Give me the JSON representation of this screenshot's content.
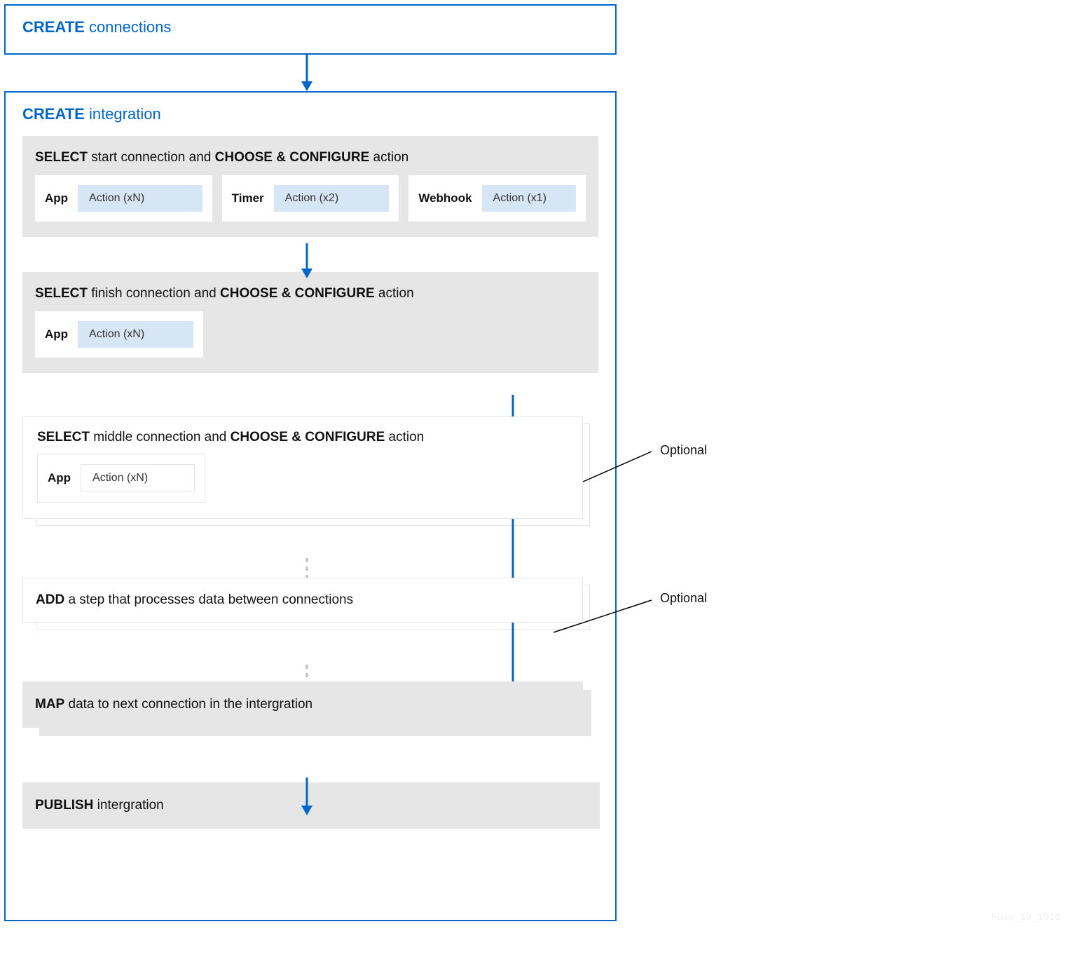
{
  "top": {
    "verb": "CREATE",
    "rest": " connections"
  },
  "main": {
    "verb": "CREATE",
    "rest": " integration"
  },
  "start": {
    "title_select": "SELECT",
    "title_mid": " start connection and ",
    "title_choose": "CHOOSE & CONFIGURE",
    "title_end": " action",
    "items": [
      {
        "label": "App",
        "action": "Action (xN)"
      },
      {
        "label": "Timer",
        "action": "Action (x2)"
      },
      {
        "label": "Webhook",
        "action": "Action (x1)"
      }
    ]
  },
  "finish": {
    "title_select": "SELECT",
    "title_mid": " finish connection and ",
    "title_choose": "CHOOSE & CONFIGURE",
    "title_end": " action",
    "item": {
      "label": "App",
      "action": "Action (xN)"
    }
  },
  "middle": {
    "title_select": "SELECT",
    "title_mid": " middle connection and ",
    "title_choose": "CHOOSE & CONFIGURE",
    "title_end": " action",
    "item": {
      "label": "App",
      "action": "Action (xN)"
    }
  },
  "add": {
    "verb": "ADD",
    "rest": " a step that processes data between connections"
  },
  "map": {
    "verb": "MAP",
    "rest": " data to next connection in the intergration"
  },
  "publish": {
    "verb": "PUBLISH",
    "rest": " intergration"
  },
  "optional": "Optional",
  "watermark": "Fuse_19_1019"
}
